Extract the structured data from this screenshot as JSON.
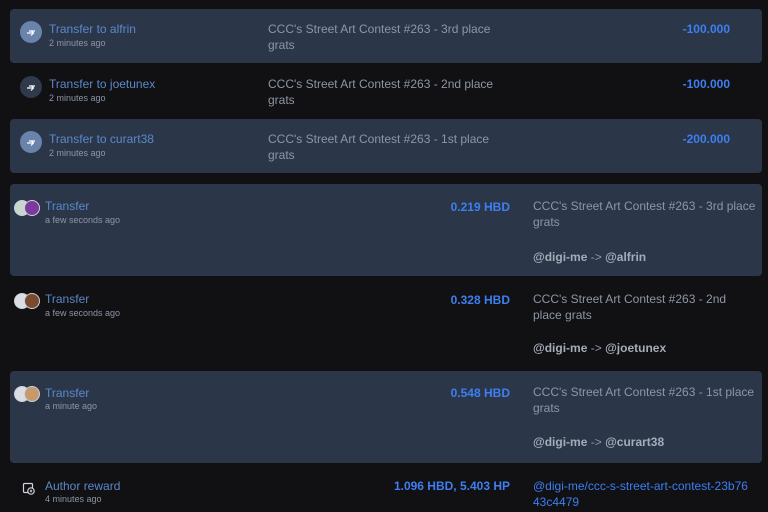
{
  "transfers_out": [
    {
      "title": "Transfer to alfrin",
      "time": "2 minutes ago",
      "memo": "CCC's Street Art Contest #263 - 3rd place grats",
      "amount": "-100.000"
    },
    {
      "title": "Transfer to joetunex",
      "time": "2 minutes ago",
      "memo": "CCC's Street Art Contest #263 - 2nd place grats",
      "amount": "-100.000"
    },
    {
      "title": "Transfer to curart38",
      "time": "2 minutes ago",
      "memo": "CCC's Street Art Contest #263 - 1st place grats",
      "amount": "-200.000"
    }
  ],
  "transfers_in": [
    {
      "title": "Transfer",
      "time": "a few seconds ago",
      "amount": "0.219 HBD",
      "memo": "CCC's Street Art Contest #263 - 3rd place grats",
      "from": "@digi-me",
      "arrow": "->",
      "to": "@alfrin"
    },
    {
      "title": "Transfer",
      "time": "a few seconds ago",
      "amount": "0.328 HBD",
      "memo": "CCC's Street Art Contest #263 - 2nd place grats",
      "from": "@digi-me",
      "arrow": "->",
      "to": "@joetunex"
    },
    {
      "title": "Transfer",
      "time": "a minute ago",
      "amount": "0.548 HBD",
      "memo": "CCC's Street Art Contest #263 - 1st place grats",
      "from": "@digi-me",
      "arrow": "->",
      "to": "@curart38"
    }
  ],
  "author_reward": {
    "title": "Author reward",
    "time": "4 minutes ago",
    "amount": "1.096 HBD, 5.403 HP",
    "link": "@digi-me/ccc-s-street-art-contest-23b7643c4479"
  },
  "icons": {
    "transfer": "transfer-icon",
    "reward": "reward-icon"
  },
  "colors": {
    "background": "#111012",
    "card": "#2b3749",
    "title": "#5b88c9",
    "amount": "#3d7ff2"
  }
}
